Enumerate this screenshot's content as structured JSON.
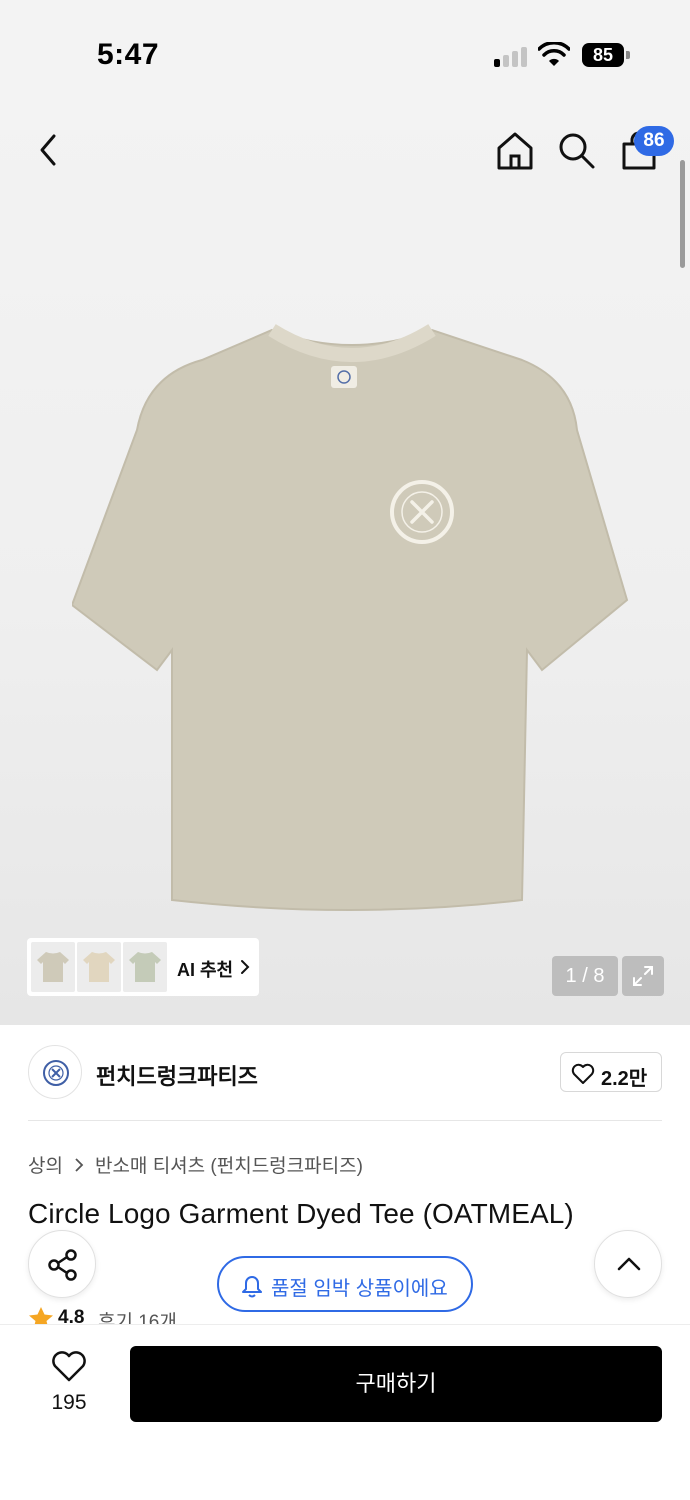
{
  "status_bar": {
    "time": "5:47",
    "battery": "85"
  },
  "header": {
    "cart_count": "86"
  },
  "gallery": {
    "ai_label": "AI 추천",
    "counter": "1 / 8"
  },
  "brand": {
    "name": "펀치드렁크파티즈",
    "like_count": "2.2만"
  },
  "breadcrumb": {
    "category": "상의",
    "subcategory": "반소매 티셔츠 (펀치드렁크파티즈)"
  },
  "product": {
    "title": "Circle Logo Garment Dyed Tee (OATMEAL)",
    "rating": "4.8",
    "review_label": "후기 16개"
  },
  "notice": {
    "soldout_text": "품절 임박 상품이에요"
  },
  "bottom_bar": {
    "like_count": "195",
    "buy_label": "구매하기"
  },
  "colors": {
    "accent": "#2f6ae5",
    "primary_button": "#000000",
    "rating_star": "#f5a623"
  },
  "icons": [
    "back-icon",
    "home-icon",
    "search-icon",
    "shopping-bag-icon",
    "expand-icon",
    "heart-icon",
    "share-icon",
    "chevron-up-icon",
    "bell-icon",
    "star-icon"
  ]
}
